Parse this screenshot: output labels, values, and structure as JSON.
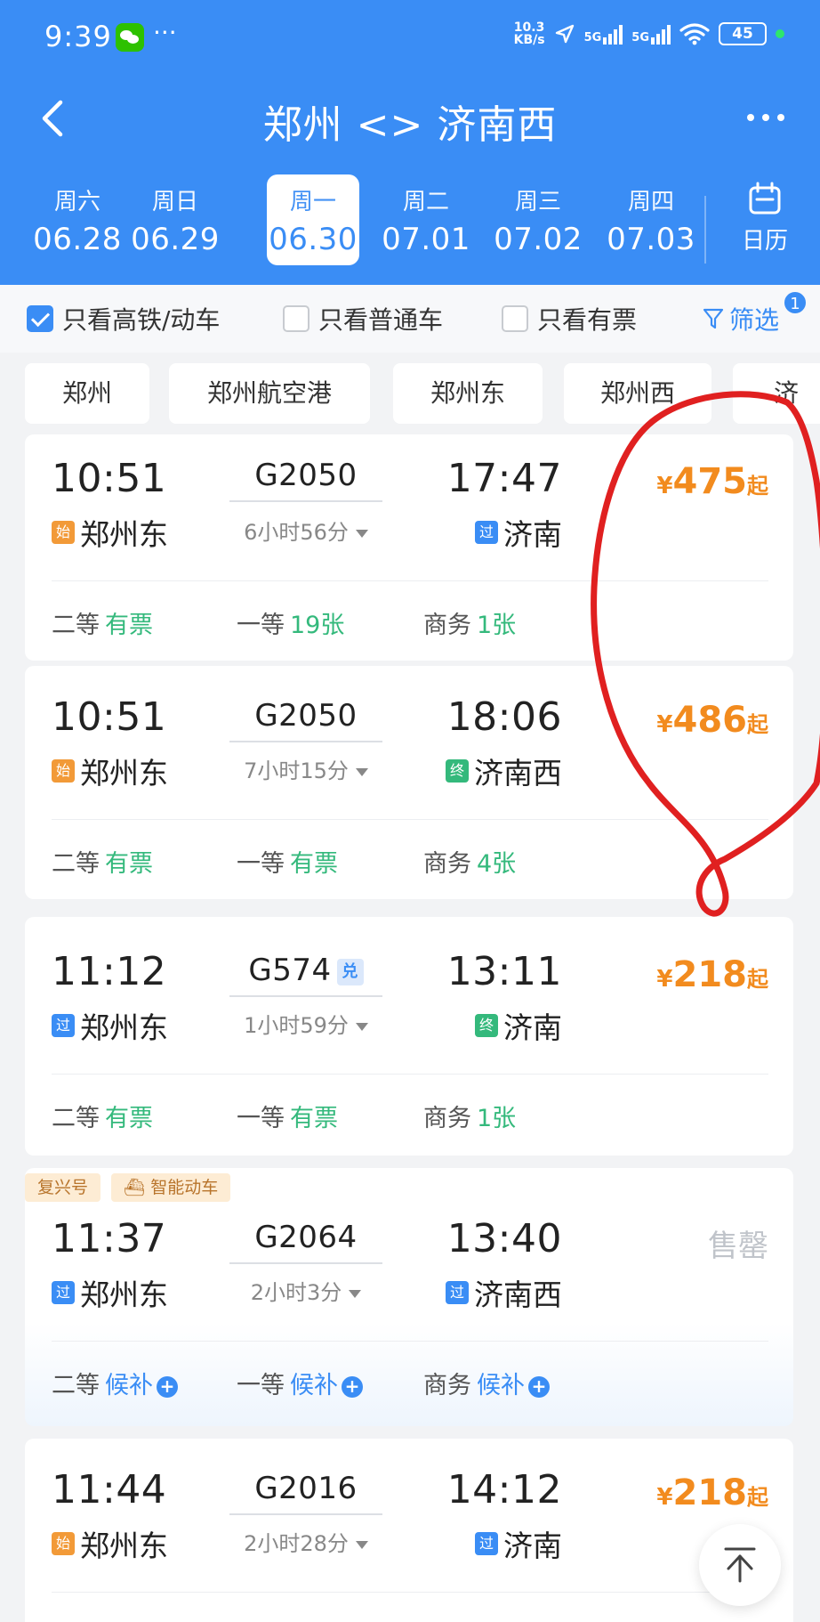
{
  "status_bar": {
    "time": "9:39",
    "dots": "···",
    "net_speed_top": "10.3",
    "net_speed_bottom": "KB/s",
    "net1": "5G",
    "net2": "5G",
    "battery": "45"
  },
  "header": {
    "title": "郑州 <> 济南西",
    "calendar_label": "日历"
  },
  "dates": [
    {
      "weekday": "周六",
      "date": "06.28",
      "active": false
    },
    {
      "weekday": "周日",
      "date": "06.29",
      "active": false
    },
    {
      "weekday": "周一",
      "date": "06.30",
      "active": true
    },
    {
      "weekday": "周二",
      "date": "07.01",
      "active": false
    },
    {
      "weekday": "周三",
      "date": "07.02",
      "active": false
    },
    {
      "weekday": "周四",
      "date": "07.03",
      "active": false
    }
  ],
  "filters": {
    "high_speed": {
      "label": "只看高铁/动车",
      "checked": true
    },
    "normal": {
      "label": "只看普通车",
      "checked": false
    },
    "available": {
      "label": "只看有票",
      "checked": false
    },
    "filter_label": "筛选",
    "filter_count": "1"
  },
  "stations": [
    "郑州",
    "郑州航空港",
    "郑州东",
    "郑州西",
    "济"
  ],
  "trains": [
    {
      "dep_time": "10:51",
      "dep_tag": "始",
      "dep_station": "郑州东",
      "train_no": "G2050",
      "duration": "6小时56分",
      "arr_time": "17:47",
      "arr_tag": "过",
      "arr_station": "济南",
      "price_currency": "¥",
      "price": "475",
      "price_suffix": "起",
      "seats": [
        {
          "label": "二等",
          "value": "有票"
        },
        {
          "label": "一等",
          "value": "19张"
        },
        {
          "label": "商务",
          "value": "1张"
        }
      ]
    },
    {
      "dep_time": "10:51",
      "dep_tag": "始",
      "dep_station": "郑州东",
      "train_no": "G2050",
      "duration": "7小时15分",
      "arr_time": "18:06",
      "arr_tag": "终",
      "arr_station": "济南西",
      "price_currency": "¥",
      "price": "486",
      "price_suffix": "起",
      "seats": [
        {
          "label": "二等",
          "value": "有票"
        },
        {
          "label": "一等",
          "value": "有票"
        },
        {
          "label": "商务",
          "value": "4张"
        }
      ]
    },
    {
      "dep_time": "11:12",
      "dep_tag": "过",
      "dep_station": "郑州东",
      "train_no": "G574",
      "train_badge": "兑",
      "duration": "1小时59分",
      "arr_time": "13:11",
      "arr_tag": "终",
      "arr_station": "济南",
      "price_currency": "¥",
      "price": "218",
      "price_suffix": "起",
      "seats": [
        {
          "label": "二等",
          "value": "有票"
        },
        {
          "label": "一等",
          "value": "有票"
        },
        {
          "label": "商务",
          "value": "1张"
        }
      ]
    },
    {
      "labels": [
        "复兴号",
        "智能动车"
      ],
      "dep_time": "11:37",
      "dep_tag": "过",
      "dep_station": "郑州东",
      "train_no": "G2064",
      "duration": "2小时3分",
      "arr_time": "13:40",
      "arr_tag": "过",
      "arr_station": "济南西",
      "status": "售罄",
      "seats": [
        {
          "label": "二等",
          "value": "候补"
        },
        {
          "label": "一等",
          "value": "候补"
        },
        {
          "label": "商务",
          "value": "候补"
        }
      ]
    },
    {
      "dep_time": "11:44",
      "dep_tag": "始",
      "dep_station": "郑州东",
      "train_no": "G2016",
      "duration": "2小时28分",
      "arr_time": "14:12",
      "arr_tag": "过",
      "arr_station": "济南",
      "price_currency": "¥",
      "price": "218",
      "price_suffix": "起"
    }
  ],
  "colors": {
    "primary": "#3a8df5",
    "price": "#f28b1e",
    "available": "#34b97c",
    "annotation": "#e02020"
  },
  "icons": {
    "back": "chevron-left-icon",
    "more": "more-icon",
    "calendar": "calendar-icon",
    "filter": "filter-funnel-icon",
    "scroll_top": "arrow-up-icon"
  }
}
